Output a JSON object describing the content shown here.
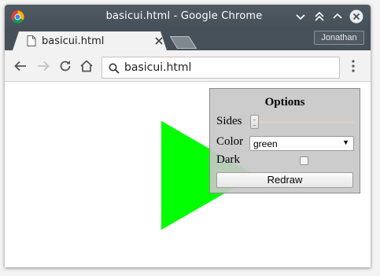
{
  "window": {
    "title": "basicui.html - Google Chrome"
  },
  "tab": {
    "title": "basicui.html"
  },
  "profile": {
    "name": "Jonathan"
  },
  "omnibox": {
    "url": "basicui.html"
  },
  "options": {
    "title": "Options",
    "sides_label": "Sides",
    "sides_value": 3,
    "color_label": "Color",
    "color_value": "green",
    "dark_label": "Dark",
    "dark_checked": false,
    "redraw_label": "Redraw"
  },
  "shape": {
    "sides": 3,
    "fill": "#00ff00"
  },
  "colors": {
    "titlebar": "#4f5a63",
    "tab_bg": "#f2f2f2",
    "panel_bg": "#c8c8c8"
  }
}
